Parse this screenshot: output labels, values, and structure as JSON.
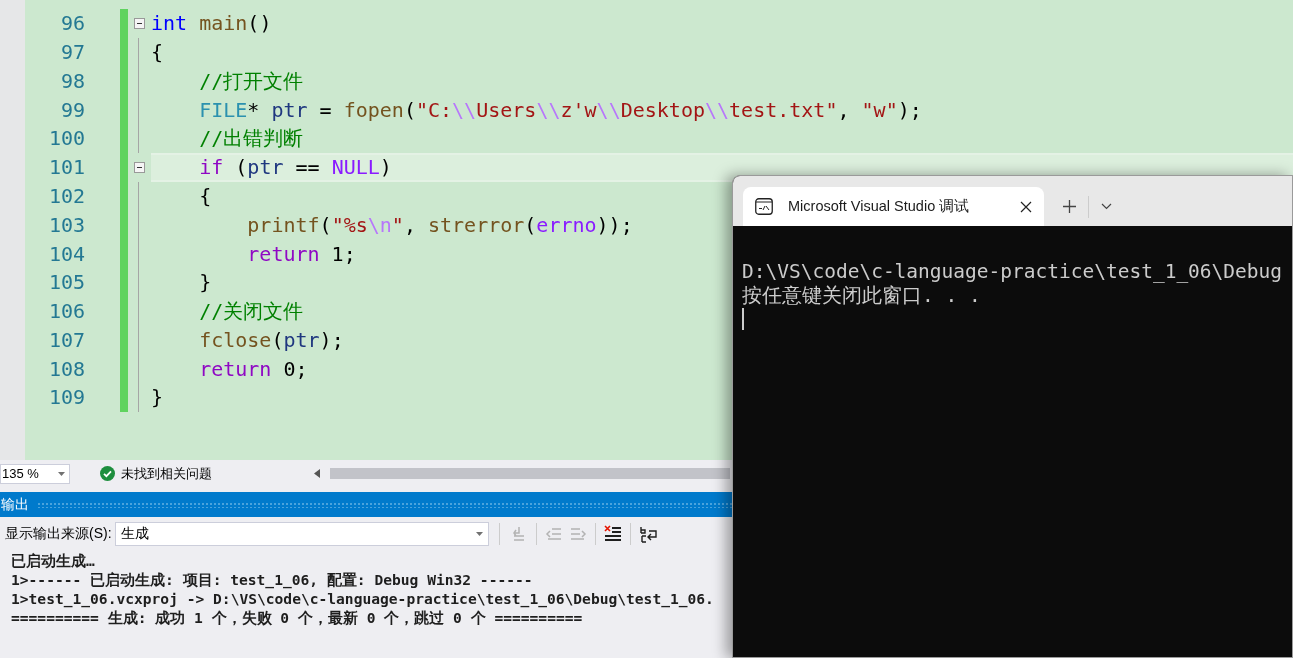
{
  "editor": {
    "lines": [
      {
        "number": "96",
        "foldable": true,
        "current": false,
        "tokens": [
          {
            "kind": "keyword",
            "text": "int"
          },
          {
            "kind": "function",
            "text": " main"
          },
          {
            "kind": "plain",
            "text": "()"
          }
        ]
      },
      {
        "number": "97",
        "foldable": false,
        "current": false,
        "tokens": [
          {
            "kind": "plain",
            "text": "{"
          }
        ]
      },
      {
        "number": "98",
        "foldable": false,
        "current": false,
        "tokens": [
          {
            "kind": "comment",
            "text": "    //打开文件"
          }
        ]
      },
      {
        "number": "99",
        "foldable": false,
        "current": false,
        "tokens": [
          {
            "kind": "type",
            "text": "    FILE"
          },
          {
            "kind": "plain",
            "text": "* "
          },
          {
            "kind": "variable",
            "text": "ptr"
          },
          {
            "kind": "plain",
            "text": " = "
          },
          {
            "kind": "function",
            "text": "fopen"
          },
          {
            "kind": "plain",
            "text": "("
          },
          {
            "kind": "string",
            "text": "\"C:"
          },
          {
            "kind": "escape",
            "text": "\\\\"
          },
          {
            "kind": "string",
            "text": "Users"
          },
          {
            "kind": "escape",
            "text": "\\\\"
          },
          {
            "kind": "string",
            "text": "z'w"
          },
          {
            "kind": "escape",
            "text": "\\\\"
          },
          {
            "kind": "string",
            "text": "Desktop"
          },
          {
            "kind": "escape",
            "text": "\\\\"
          },
          {
            "kind": "string",
            "text": "test.txt\""
          },
          {
            "kind": "plain",
            "text": ", "
          },
          {
            "kind": "string",
            "text": "\"w\""
          },
          {
            "kind": "plain",
            "text": ");"
          }
        ]
      },
      {
        "number": "100",
        "foldable": false,
        "current": false,
        "tokens": [
          {
            "kind": "comment",
            "text": "    //出错判断"
          }
        ]
      },
      {
        "number": "101",
        "foldable": true,
        "current": true,
        "tokens": [
          {
            "kind": "control",
            "text": "    if"
          },
          {
            "kind": "plain",
            "text": " ("
          },
          {
            "kind": "variable",
            "text": "ptr"
          },
          {
            "kind": "plain",
            "text": " == "
          },
          {
            "kind": "macro",
            "text": "NULL"
          },
          {
            "kind": "plain",
            "text": ")"
          }
        ]
      },
      {
        "number": "102",
        "foldable": false,
        "current": false,
        "tokens": [
          {
            "kind": "plain",
            "text": "    {"
          }
        ]
      },
      {
        "number": "103",
        "foldable": false,
        "current": false,
        "tokens": [
          {
            "kind": "function",
            "text": "        printf"
          },
          {
            "kind": "plain",
            "text": "("
          },
          {
            "kind": "string",
            "text": "\"%s"
          },
          {
            "kind": "escape",
            "text": "\\n"
          },
          {
            "kind": "string",
            "text": "\""
          },
          {
            "kind": "plain",
            "text": ", "
          },
          {
            "kind": "function",
            "text": "strerror"
          },
          {
            "kind": "plain",
            "text": "("
          },
          {
            "kind": "macro",
            "text": "errno"
          },
          {
            "kind": "plain",
            "text": "));"
          }
        ]
      },
      {
        "number": "104",
        "foldable": false,
        "current": false,
        "tokens": [
          {
            "kind": "control",
            "text": "        return"
          },
          {
            "kind": "plain",
            "text": " 1;"
          }
        ]
      },
      {
        "number": "105",
        "foldable": false,
        "current": false,
        "tokens": [
          {
            "kind": "plain",
            "text": "    }"
          }
        ]
      },
      {
        "number": "106",
        "foldable": false,
        "current": false,
        "tokens": [
          {
            "kind": "comment",
            "text": "    //关闭文件"
          }
        ]
      },
      {
        "number": "107",
        "foldable": false,
        "current": false,
        "tokens": [
          {
            "kind": "function",
            "text": "    fclose"
          },
          {
            "kind": "plain",
            "text": "("
          },
          {
            "kind": "variable",
            "text": "ptr"
          },
          {
            "kind": "plain",
            "text": ");"
          }
        ]
      },
      {
        "number": "108",
        "foldable": false,
        "current": false,
        "tokens": [
          {
            "kind": "control",
            "text": "    return"
          },
          {
            "kind": "plain",
            "text": " 0;"
          }
        ]
      },
      {
        "number": "109",
        "foldable": false,
        "current": false,
        "tokens": [
          {
            "kind": "plain",
            "text": "}"
          }
        ]
      }
    ]
  },
  "status_bar": {
    "zoom": "135 %",
    "issues": "未找到相关问题"
  },
  "output": {
    "title": "输出",
    "source_label": "显示输出来源(S):",
    "source": "生成",
    "lines": [
      "已启动生成…",
      "1>------ 已启动生成: 项目: test_1_06, 配置: Debug Win32 ------",
      "1>test_1_06.vcxproj -> D:\\VS\\code\\c-language-practice\\test_1_06\\Debug\\test_1_06.",
      "========== 生成: 成功 1 个，失败 0 个，最新 0 个，跳过 0 个 =========="
    ]
  },
  "console": {
    "tab_title": "Microsoft Visual Studio 调试",
    "lines": [
      "D:\\VS\\code\\c-language-practice\\test_1_06\\Debug",
      "按任意键关闭此窗口. . ."
    ]
  }
}
